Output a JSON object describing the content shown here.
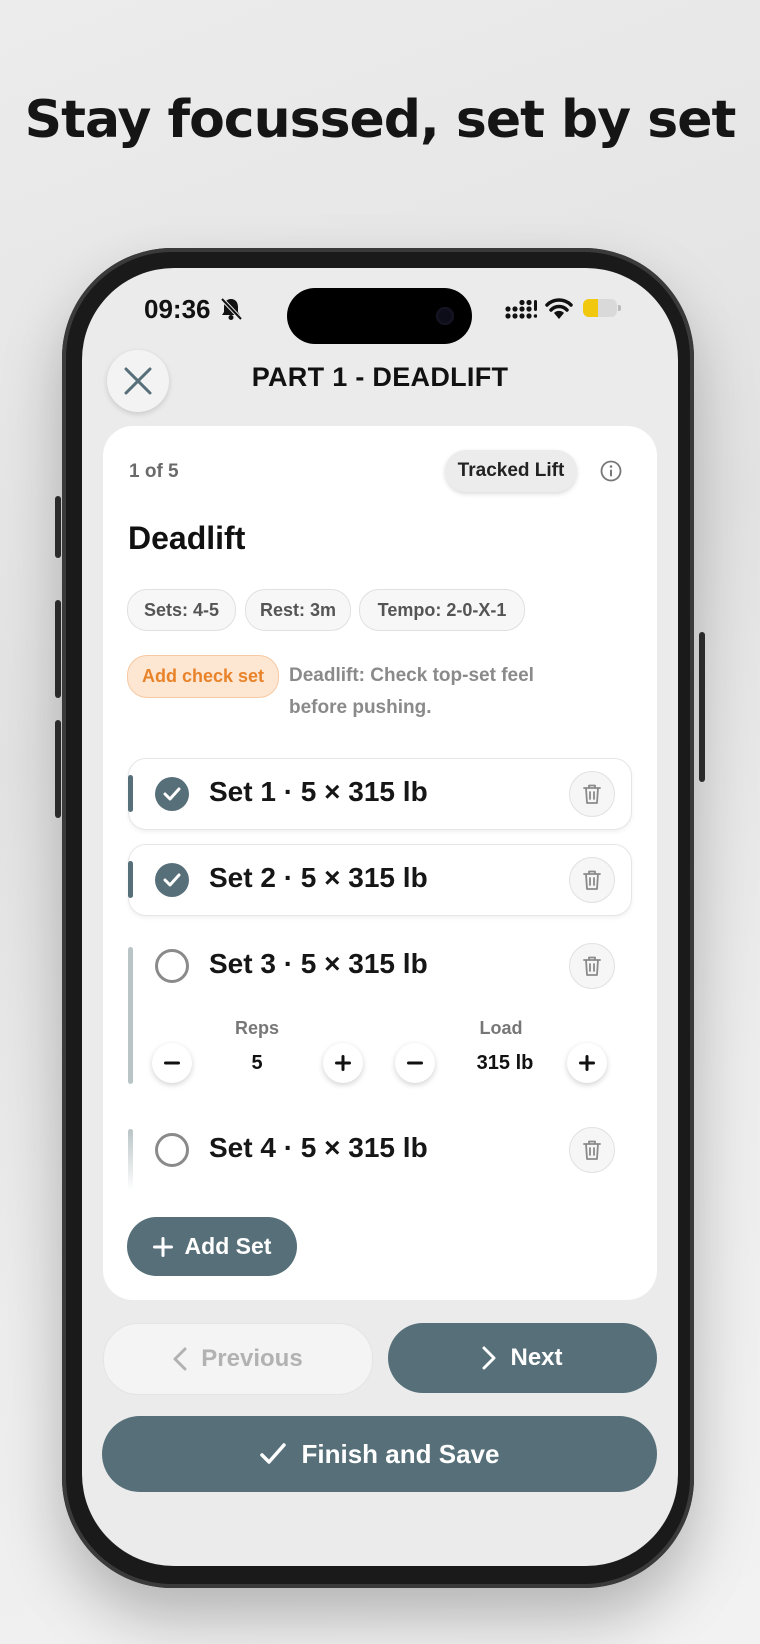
{
  "headline": "Stay focussed, set by set",
  "status_bar": {
    "time": "09:36",
    "icons": [
      "bell-slash-icon",
      "signal-icon",
      "wifi-icon",
      "battery-icon"
    ]
  },
  "header": {
    "title": "PART 1 - DEADLIFT",
    "close_icon": "close-icon"
  },
  "exercise": {
    "counter": "1 of 5",
    "badge": "Tracked Lift",
    "name": "Deadlift",
    "chips": [
      "Sets: 4-5",
      "Rest: 3m",
      "Tempo: 2-0-X-1"
    ],
    "check_set_label": "Add check set",
    "note": "Deadlift: Check top-set feel before pushing."
  },
  "sets": [
    {
      "label": "Set 1 · 5 × 315 lb",
      "done": true
    },
    {
      "label": "Set 2 · 5 × 315 lb",
      "done": true
    },
    {
      "label": "Set 3 · 5 × 315 lb",
      "done": false
    },
    {
      "label": "Set 4 · 5 × 315 lb",
      "done": false
    }
  ],
  "editor": {
    "reps_label": "Reps",
    "reps_value": "5",
    "load_label": "Load",
    "load_value": "315 lb"
  },
  "actions": {
    "add_set": "Add Set",
    "previous": "Previous",
    "next": "Next",
    "finish": "Finish and Save"
  },
  "colors": {
    "accent": "#566f79",
    "orange": "#e8832a",
    "orange_bg": "#fde6d2",
    "battery": "#f2c80f"
  }
}
